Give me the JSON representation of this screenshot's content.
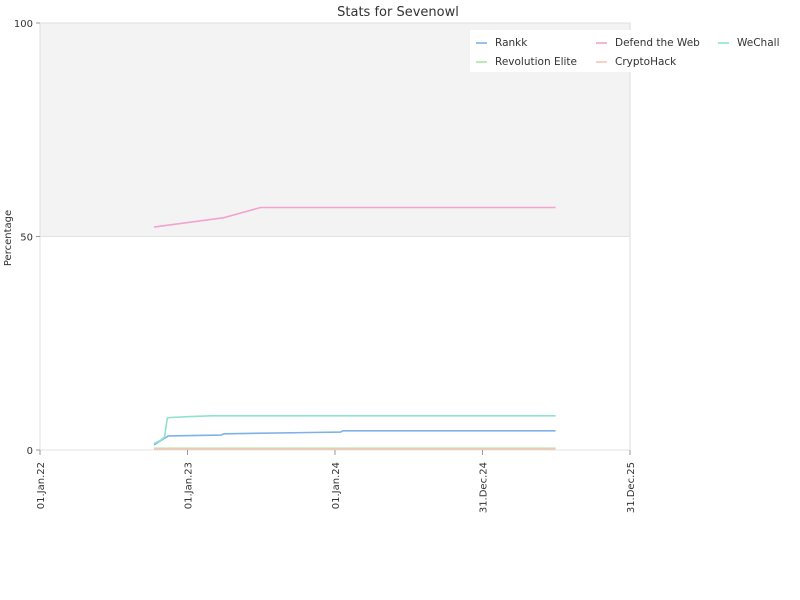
{
  "chart_data": {
    "type": "line",
    "title": "Stats for Sevenowl",
    "xlabel": "",
    "ylabel": "Percentage",
    "ylim": [
      0,
      100
    ],
    "xlim": [
      "2022-01-01",
      "2025-12-31"
    ],
    "y_ticks": [
      0,
      50,
      100
    ],
    "x_ticks": [
      {
        "date": "2022-01-01",
        "label": "01.Jan.22"
      },
      {
        "date": "2023-01-01",
        "label": "01.Jan.23"
      },
      {
        "date": "2024-01-01",
        "label": "01.Jan.24"
      },
      {
        "date": "2024-12-31",
        "label": "31.Dec.24"
      },
      {
        "date": "2025-12-31",
        "label": "31.Dec.25"
      }
    ],
    "grid": true,
    "legend_position": "top-right",
    "series": [
      {
        "name": "Rankk",
        "color": "#7fb1e6",
        "points": [
          [
            "2022-10-10",
            1.2
          ],
          [
            "2022-10-20",
            1.8
          ],
          [
            "2022-11-01",
            2.5
          ],
          [
            "2022-11-15",
            3.3
          ],
          [
            "2023-03-25",
            3.5
          ],
          [
            "2023-04-01",
            3.8
          ],
          [
            "2023-11-01",
            4.1
          ],
          [
            "2024-01-15",
            4.2
          ],
          [
            "2024-01-20",
            4.5
          ],
          [
            "2025-06-30",
            4.5
          ]
        ]
      },
      {
        "name": "Revolution Elite",
        "color": "#a8e6a0",
        "points": [
          [
            "2022-10-10",
            0.4
          ],
          [
            "2025-06-30",
            0.4
          ]
        ]
      },
      {
        "name": "Defend the Web",
        "color": "#f2a3cf",
        "points": [
          [
            "2022-10-10",
            52.2
          ],
          [
            "2023-04-01",
            54.4
          ],
          [
            "2023-07-01",
            56.8
          ],
          [
            "2025-06-30",
            56.8
          ]
        ]
      },
      {
        "name": "CryptoHack",
        "color": "#f5c6b8",
        "points": [
          [
            "2022-10-10",
            0.2
          ],
          [
            "2025-06-30",
            0.2
          ]
        ]
      },
      {
        "name": "WeChall",
        "color": "#8ee3cf",
        "points": [
          [
            "2022-10-10",
            1.5
          ],
          [
            "2022-10-25",
            2.2
          ],
          [
            "2022-11-05",
            3.0
          ],
          [
            "2022-11-12",
            7.5
          ],
          [
            "2022-11-20",
            7.6
          ],
          [
            "2023-01-01",
            7.8
          ],
          [
            "2023-03-01",
            8.0
          ],
          [
            "2025-06-30",
            8.0
          ]
        ]
      }
    ]
  }
}
